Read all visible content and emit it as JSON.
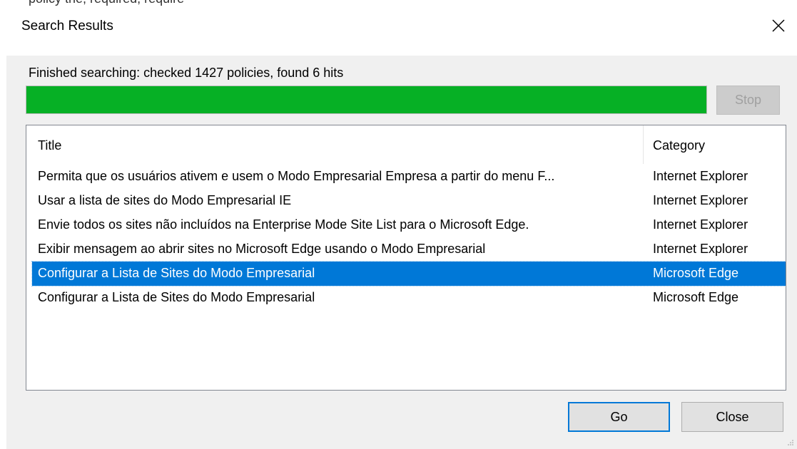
{
  "window": {
    "title": "Search Results",
    "close_glyph": "✕",
    "partial_top_text": "policy the, required, require"
  },
  "status": {
    "text": "Finished searching: checked 1427 policies, found 6 hits",
    "progress_percent": 100,
    "progress_color": "#06b025"
  },
  "buttons": {
    "stop_label": "Stop",
    "go_label": "Go",
    "close_label": "Close"
  },
  "table": {
    "columns": [
      "Title",
      "Category"
    ],
    "rows": [
      {
        "title": "Permita que os usuários ativem e usem o Modo Empresarial Empresa a partir do menu F...",
        "category": "Internet Explorer"
      },
      {
        "title": "Usar a lista de sites do Modo Empresarial IE",
        "category": "Internet Explorer"
      },
      {
        "title": "Envie todos os sites não incluídos na Enterprise Mode Site List para o Microsoft Edge.",
        "category": "Internet Explorer"
      },
      {
        "title": "Exibir mensagem ao abrir sites no Microsoft Edge usando o Modo Empresarial",
        "category": "Internet Explorer"
      },
      {
        "title": "Configurar a Lista de Sites do Modo Empresarial",
        "category": "Microsoft Edge"
      },
      {
        "title": "Configurar a Lista de Sites do Modo Empresarial",
        "category": "Microsoft Edge"
      }
    ],
    "selected_index": 4,
    "selection_color": "#0078d7"
  }
}
